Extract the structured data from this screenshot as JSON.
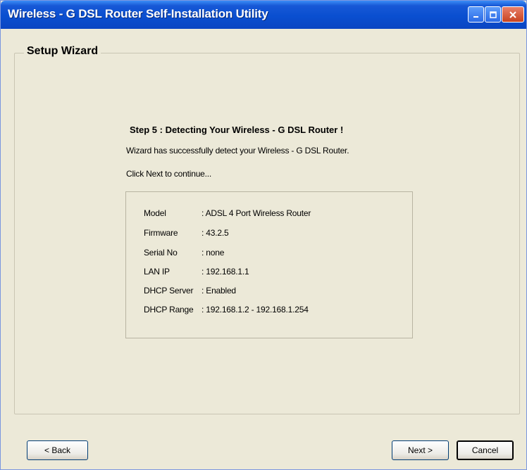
{
  "window": {
    "title": "Wireless - G DSL Router Self-Installation Utility"
  },
  "group": {
    "label": "Setup Wizard"
  },
  "step": {
    "title": "Step 5 : Detecting Your Wireless - G DSL Router !",
    "message": "Wizard has successfully detect your Wireless - G DSL Router.",
    "instruction": "Click Next to continue..."
  },
  "info": [
    {
      "label": "Model",
      "value": ": ADSL 4 Port Wireless Router"
    },
    {
      "label": "Firmware",
      "value": ": 43.2.5"
    },
    {
      "label": "Serial No",
      "value": ": none"
    },
    {
      "label": "LAN IP",
      "value": ": 192.168.1.1"
    },
    {
      "label": "DHCP Server",
      "value": ": Enabled"
    },
    {
      "label": "DHCP Range",
      "value": ": 192.168.1.2 - 192.168.1.254"
    }
  ],
  "buttons": {
    "back": "< Back",
    "next": "Next >",
    "cancel": "Cancel"
  }
}
